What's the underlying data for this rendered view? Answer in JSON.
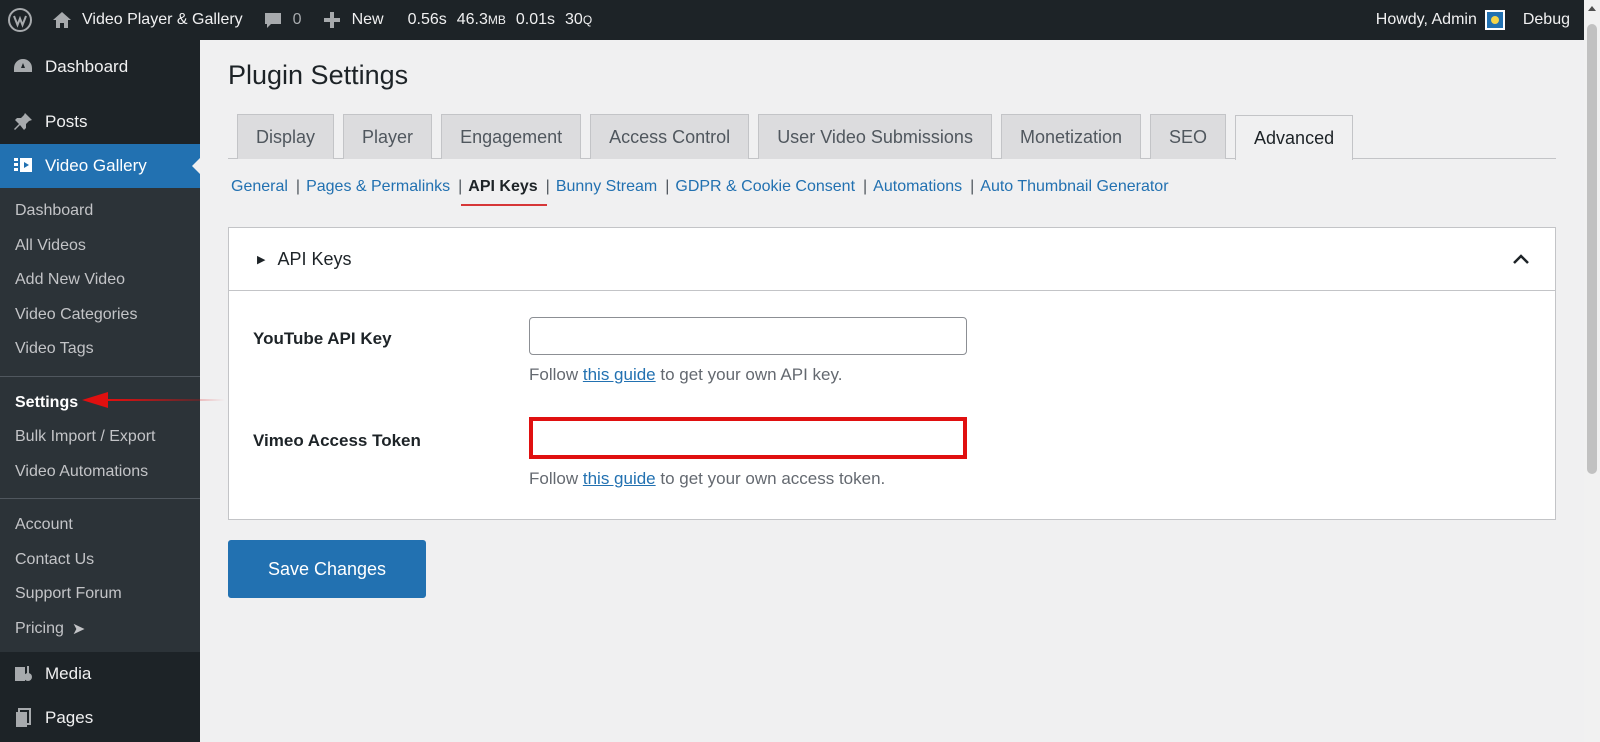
{
  "adminbar": {
    "site_name": "Video Player & Gallery",
    "comments_count": "0",
    "new_label": "New",
    "perf": {
      "time": "0.56s",
      "memory_value": "46.3",
      "memory_unit": "MB",
      "query_time": "0.01s",
      "queries_value": "30",
      "queries_unit": "Q"
    },
    "howdy": "Howdy, Admin",
    "debug": "Debug"
  },
  "sidebar": {
    "dashboard": "Dashboard",
    "posts": "Posts",
    "video_gallery": "Video Gallery",
    "submenu": {
      "dashboard": "Dashboard",
      "all_videos": "All Videos",
      "add_new_video": "Add New Video",
      "video_categories": "Video Categories",
      "video_tags": "Video Tags",
      "settings": "Settings",
      "bulk_import_export": "Bulk Import / Export",
      "video_automations": "Video Automations",
      "account": "Account",
      "contact_us": "Contact Us",
      "support_forum": "Support Forum",
      "pricing": "Pricing",
      "pricing_arrow": "➤"
    },
    "media": "Media",
    "pages": "Pages"
  },
  "main": {
    "title": "Plugin Settings",
    "tabs": [
      {
        "label": "Display"
      },
      {
        "label": "Player"
      },
      {
        "label": "Engagement"
      },
      {
        "label": "Access Control"
      },
      {
        "label": "User Video Submissions"
      },
      {
        "label": "Monetization"
      },
      {
        "label": "SEO"
      },
      {
        "label": "Advanced"
      }
    ],
    "subnav": [
      {
        "label": "General"
      },
      {
        "label": "Pages & Permalinks"
      },
      {
        "label": "API Keys"
      },
      {
        "label": "Bunny Stream"
      },
      {
        "label": "GDPR & Cookie Consent"
      },
      {
        "label": "Automations"
      },
      {
        "label": "Auto Thumbnail Generator"
      }
    ],
    "separator": "|",
    "section": {
      "title": "API Keys",
      "youtube": {
        "label": "YouTube API Key",
        "value": "",
        "desc_before": "Follow ",
        "desc_link": "this guide",
        "desc_after": " to get your own API key."
      },
      "vimeo": {
        "label": "Vimeo Access Token",
        "value": "",
        "desc_before": "Follow ",
        "desc_link": "this guide",
        "desc_after": " to get your own access token."
      }
    },
    "save_label": "Save Changes"
  },
  "colors": {
    "accent": "#2271b1",
    "sidebar_bg": "#1d2327",
    "annotation_red": "#e01010"
  }
}
